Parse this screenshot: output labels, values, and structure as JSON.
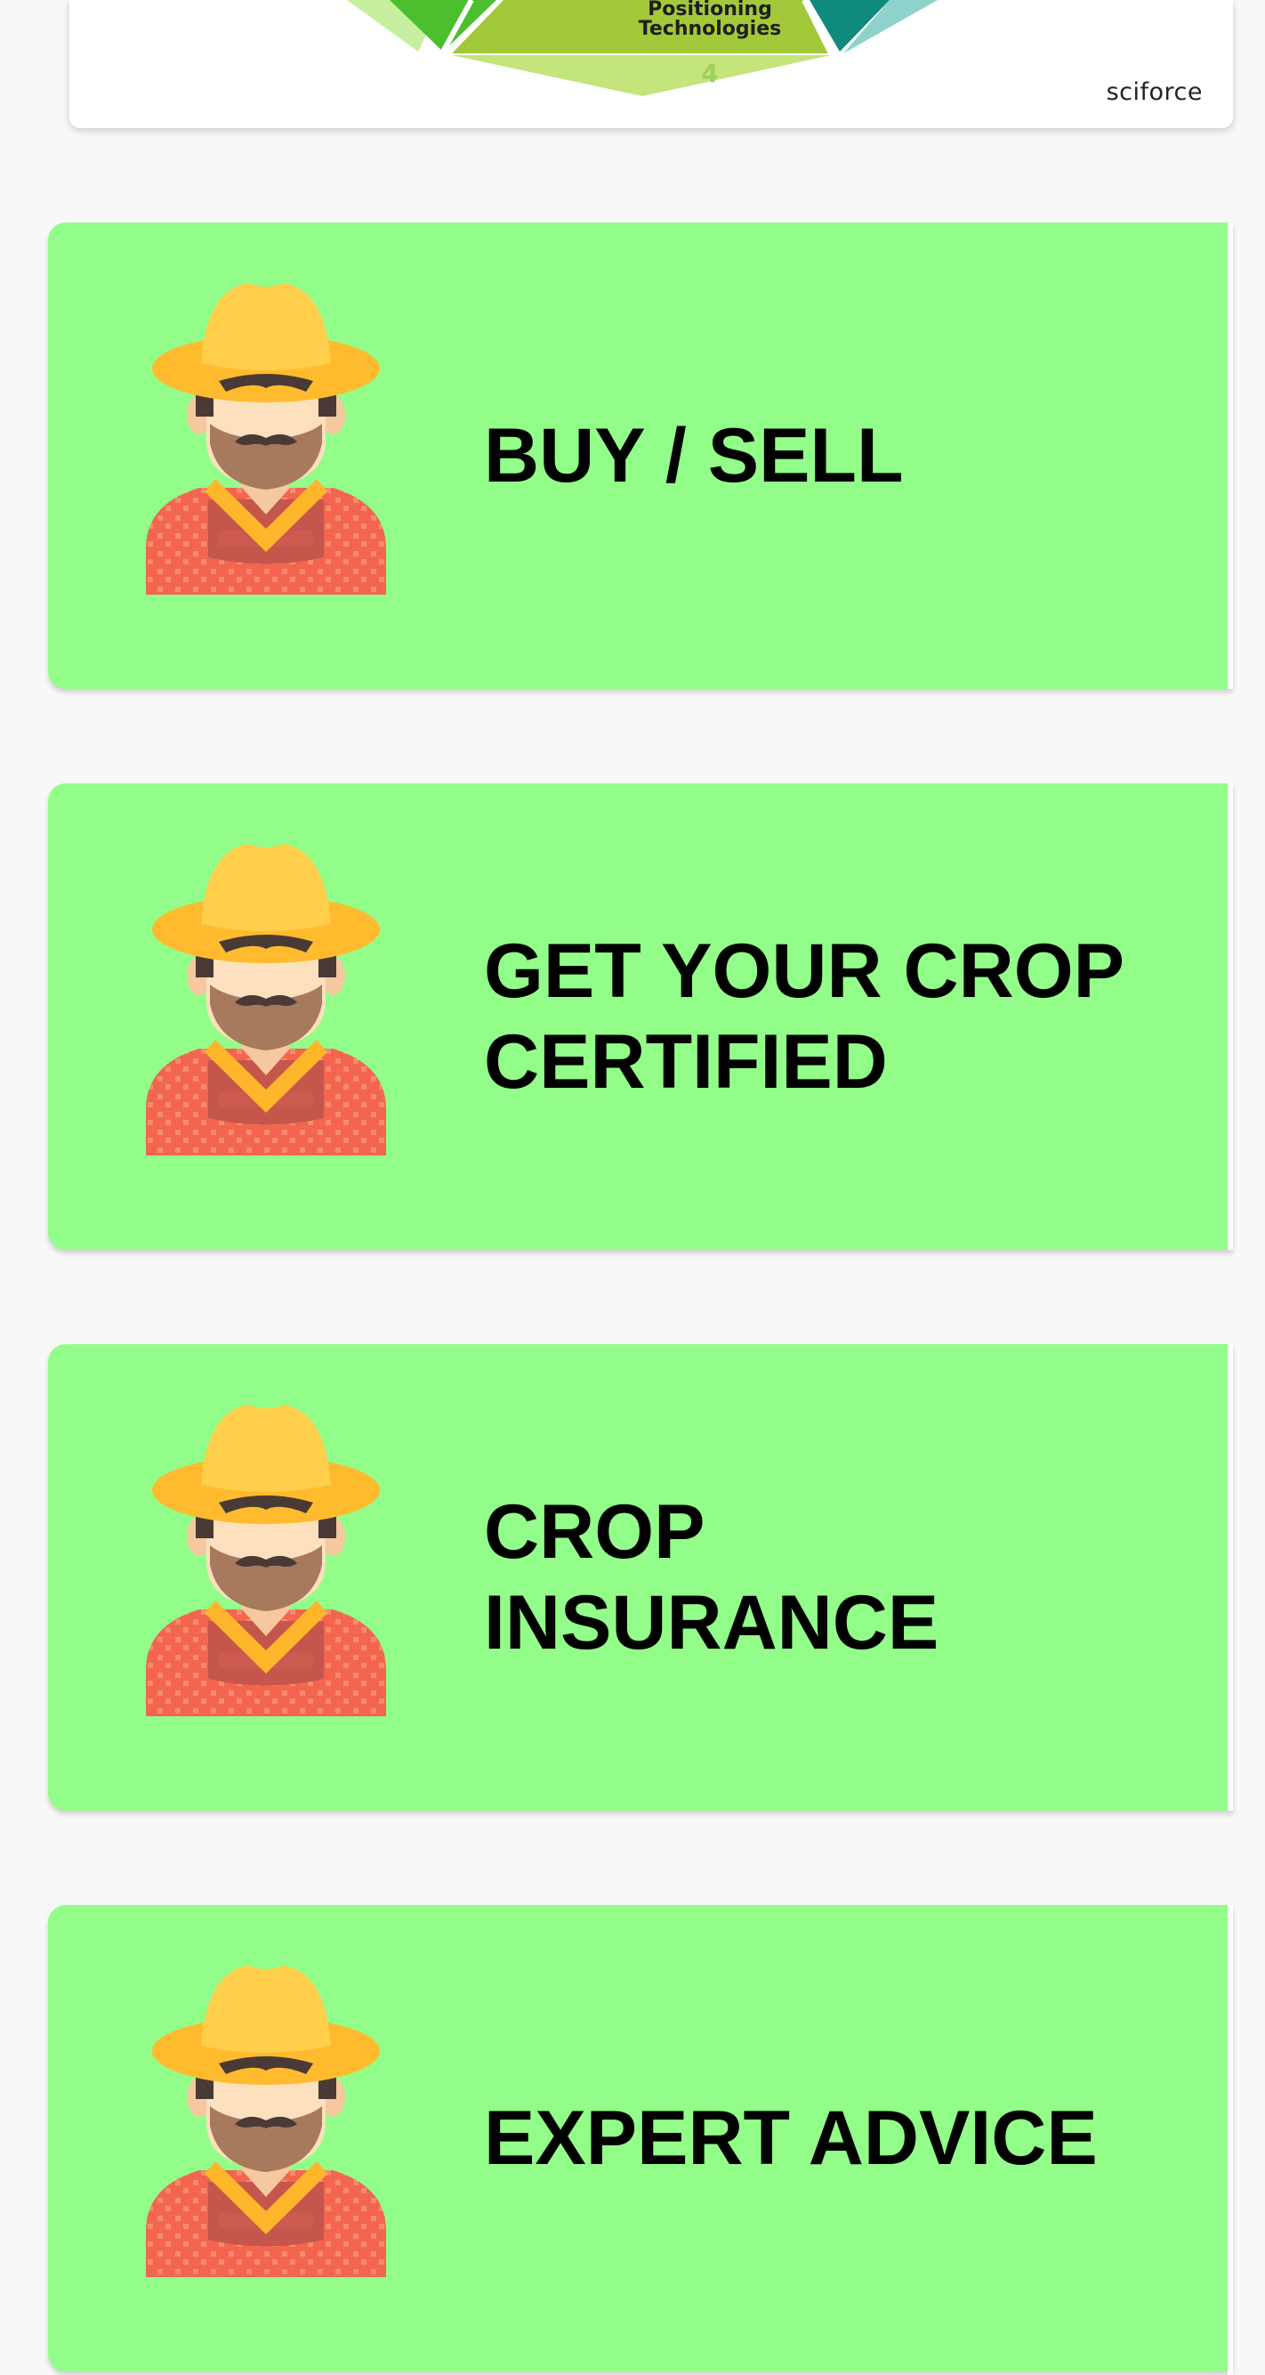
{
  "infographic": {
    "segment_label_line1": "Positioning",
    "segment_label_line2": "Technologies",
    "segment_number": "4",
    "brand": "sciforce",
    "colors": {
      "lime": "#a3c93a",
      "lime_light": "#c4e47c",
      "green": "#4cbf2c",
      "teal": "#0f8b7d",
      "teal_light": "#8ed2cb"
    }
  },
  "cards": [
    {
      "label": "BUY / SELL",
      "icon": "farmer-icon"
    },
    {
      "label": "GET YOUR CROP\nCERTIFIED",
      "icon": "farmer-icon"
    },
    {
      "label": "CROP\nINSURANCE",
      "icon": "farmer-icon"
    },
    {
      "label": "EXPERT ADVICE",
      "icon": "farmer-icon"
    }
  ],
  "colors": {
    "card_background": "#93fd89",
    "page_background": "#f8f8f8"
  }
}
